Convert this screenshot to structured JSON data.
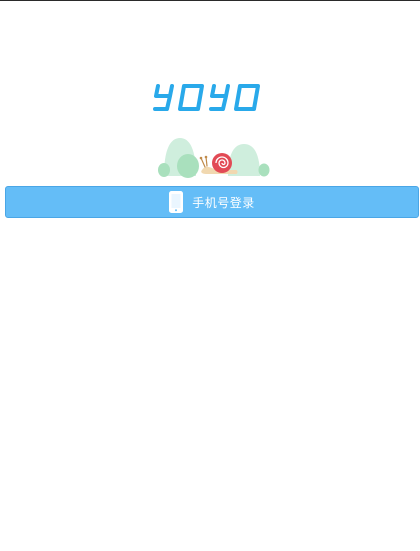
{
  "app": {
    "logo_text": "YOYO",
    "logo_color": "#29a9ea"
  },
  "illustration": {
    "name": "snail-hills-icon"
  },
  "login": {
    "button_label": "手机号登录",
    "icon": "phone-icon",
    "button_color": "#64bdf7"
  }
}
